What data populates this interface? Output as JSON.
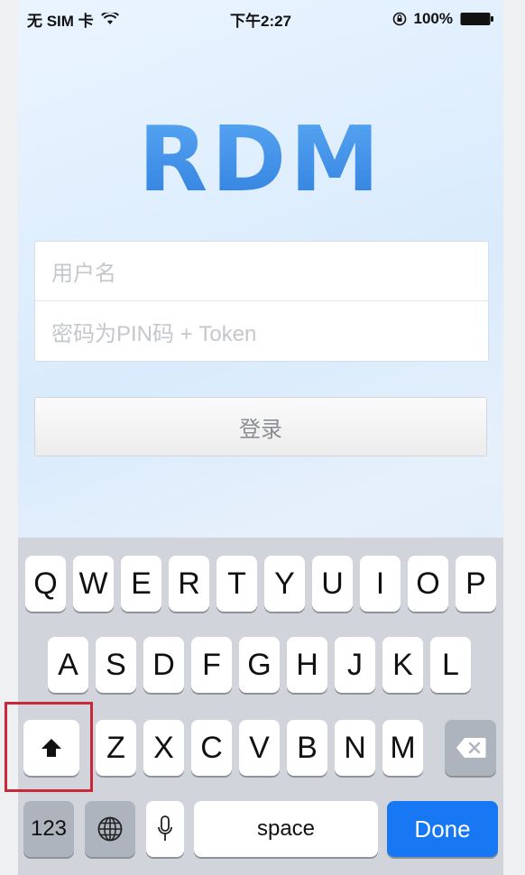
{
  "status_bar": {
    "carrier": "无 SIM 卡",
    "time": "下午2:27",
    "battery": "100%",
    "icons": [
      "wifi-icon",
      "rotation-lock-icon",
      "battery-icon"
    ]
  },
  "logo": {
    "text": "RDM"
  },
  "form": {
    "username_placeholder": "用户名",
    "password_placeholder": "密码为PIN码 + Token",
    "login_label": "登录"
  },
  "keyboard": {
    "row1": [
      "Q",
      "W",
      "E",
      "R",
      "T",
      "Y",
      "U",
      "I",
      "O",
      "P"
    ],
    "row2": [
      "A",
      "S",
      "D",
      "F",
      "G",
      "H",
      "J",
      "K",
      "L"
    ],
    "row3": [
      "Z",
      "X",
      "C",
      "V",
      "B",
      "N",
      "M"
    ],
    "numbers_label": "123",
    "space_label": "space",
    "done_label": "Done",
    "icons": [
      "shift-icon",
      "backspace-icon",
      "globe-icon",
      "microphone-icon"
    ]
  },
  "colors": {
    "accent": "#1878f4",
    "logo": "#3f8fe8",
    "highlight": "#c8283a"
  }
}
